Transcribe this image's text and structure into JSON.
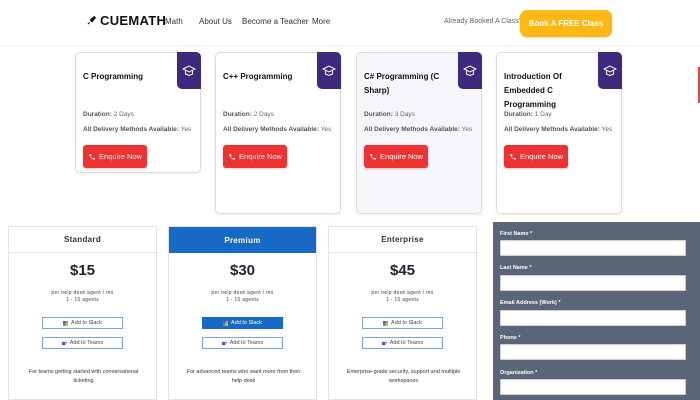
{
  "header": {
    "logo_text": "CUEMATH",
    "nav": [
      "Math",
      "About Us",
      "Become a Teacher",
      "More"
    ],
    "already_booked": "Already Booked A Class?",
    "cta_label": "Book A FREE Class"
  },
  "courses": [
    {
      "title": "C Programming",
      "duration_label": "Duration:",
      "duration": "2 Days",
      "delivery_label": "All Delivery Methods Available:",
      "delivery": "Yes",
      "button": "Enquire Now"
    },
    {
      "title": "C++ Programming",
      "duration_label": "Duration:",
      "duration": "2 Days",
      "delivery_label": "All Delivery Methods Available:",
      "delivery": "Yes",
      "button": "Enquire Now"
    },
    {
      "title": "C# Programming (C Sharp)",
      "duration_label": "Duration:",
      "duration": "3 Days",
      "delivery_label": "All Delivery Methods Available:",
      "delivery": "Yes",
      "button": "Enquire Now"
    },
    {
      "title": "Introduction Of Embedded C Programming",
      "duration_label": "Duration:",
      "duration": "1 Day",
      "delivery_label": "All Delivery Methods Available:",
      "delivery": "Yes",
      "button": "Enquire Now"
    }
  ],
  "plans": [
    {
      "name": "Standard",
      "price": "$15",
      "unit": "per help desk agent / mo",
      "range": "1 - 15 agents",
      "slack": "Add to Slack",
      "teams": "Add to Teams",
      "desc": "For teams getting started with conversational ticketing"
    },
    {
      "name": "Premium",
      "price": "$30",
      "unit": "per help desk agent / mo",
      "range": "1 - 15 agents",
      "slack": "Add to Slack",
      "teams": "Add to Teams",
      "desc": "For advanced teams who want more from their help desk"
    },
    {
      "name": "Enterprise",
      "price": "$45",
      "unit": "per help desk agent / mo",
      "range": "1 - 15 agents",
      "slack": "Add to Slack",
      "teams": "Add to Teams",
      "desc": "Enterprise-grade security, support and multiple workspaces"
    }
  ],
  "form": {
    "fields": [
      "First Name *",
      "Last Name *",
      "Email Address (Work) *",
      "Phone *",
      "Organization *"
    ]
  },
  "colors": {
    "brand_purple": "#3d2a7d",
    "enquire_red": "#ee3131",
    "cta_yellow": "#fdb813",
    "premium_blue": "#1769c6",
    "form_bg": "#5a6677"
  },
  "icons": {
    "logo": "rocket-icon",
    "course_badge": "graduation-cap-icon",
    "enquire": "phone-icon",
    "slack": "slack-icon",
    "teams": "teams-icon"
  }
}
